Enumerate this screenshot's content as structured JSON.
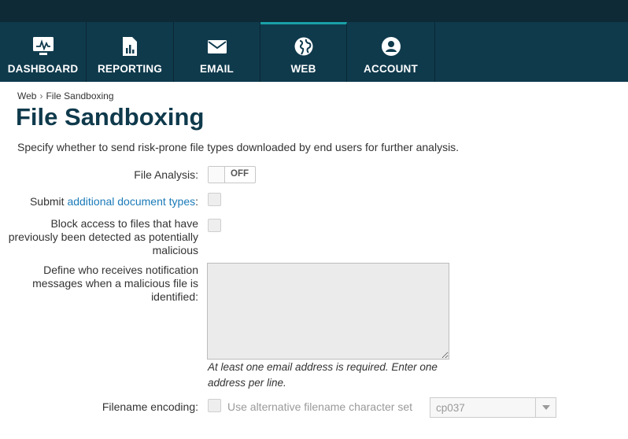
{
  "nav": {
    "tabs": [
      {
        "label": "DASHBOARD",
        "icon": "dashboard-monitor-icon"
      },
      {
        "label": "REPORTING",
        "icon": "report-document-icon"
      },
      {
        "label": "EMAIL",
        "icon": "envelope-icon"
      },
      {
        "label": "WEB",
        "icon": "globe-icon",
        "active": true
      },
      {
        "label": "ACCOUNT",
        "icon": "user-account-icon"
      }
    ]
  },
  "breadcrumb": {
    "parent": "Web",
    "separator": "›",
    "current": "File Sandboxing"
  },
  "page": {
    "title": "File Sandboxing",
    "description": "Specify whether to send risk-prone file types downloaded by end users for further analysis."
  },
  "form": {
    "file_analysis": {
      "label": "File Analysis:",
      "state": "OFF"
    },
    "submit_docs": {
      "label_prefix": "Submit ",
      "link": "additional document types",
      "label_suffix": ":",
      "checked": false
    },
    "block_access": {
      "label": "Block access to files that have previously been detected as potentially malicious",
      "checked": false
    },
    "notify": {
      "label": "Define who receives notification messages when a malicious file is identified:",
      "value": "",
      "hint": "At least one email address is required. Enter one address per line."
    },
    "filename_encoding": {
      "label": "Filename encoding:",
      "checkbox_label": "Use alternative filename character set",
      "checked": false,
      "select_value": "cp037"
    }
  },
  "colors": {
    "nav_bg": "#0f3a4c",
    "top_strip": "#0d2a36",
    "active_accent": "#1aa0a8",
    "title": "#0f3a4c",
    "link": "#1a7ab8"
  }
}
